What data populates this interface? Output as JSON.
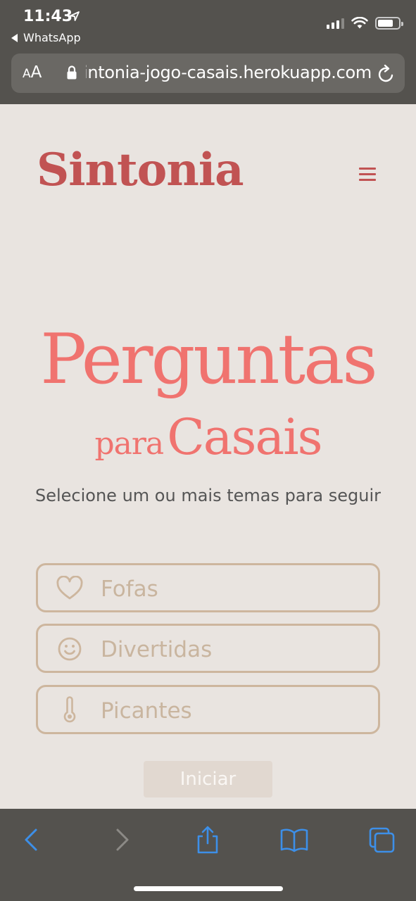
{
  "status_bar": {
    "time": "11:43",
    "back_app": "WhatsApp"
  },
  "url_bar": {
    "text_size_small": "A",
    "text_size_big": "A",
    "url": "sintonia-jogo-casais.herokuapp.com"
  },
  "header": {
    "brand": "Sintonia"
  },
  "hero": {
    "title": "Perguntas",
    "sub_small": "para",
    "sub_big": "Casais",
    "instruction": "Selecione um ou mais temas para seguir"
  },
  "themes": [
    {
      "label": "Fofas",
      "icon": "heart-icon"
    },
    {
      "label": "Divertidas",
      "icon": "smiley-icon"
    },
    {
      "label": "Picantes",
      "icon": "thermometer-icon"
    }
  ],
  "start_button": {
    "label": "Iniciar"
  },
  "colors": {
    "brand": "#c15353",
    "hero": "#f0736f",
    "theme_border": "#cdb69e",
    "page_bg": "#e9e4e0",
    "toolbar_icons": "#3d8fe8"
  }
}
